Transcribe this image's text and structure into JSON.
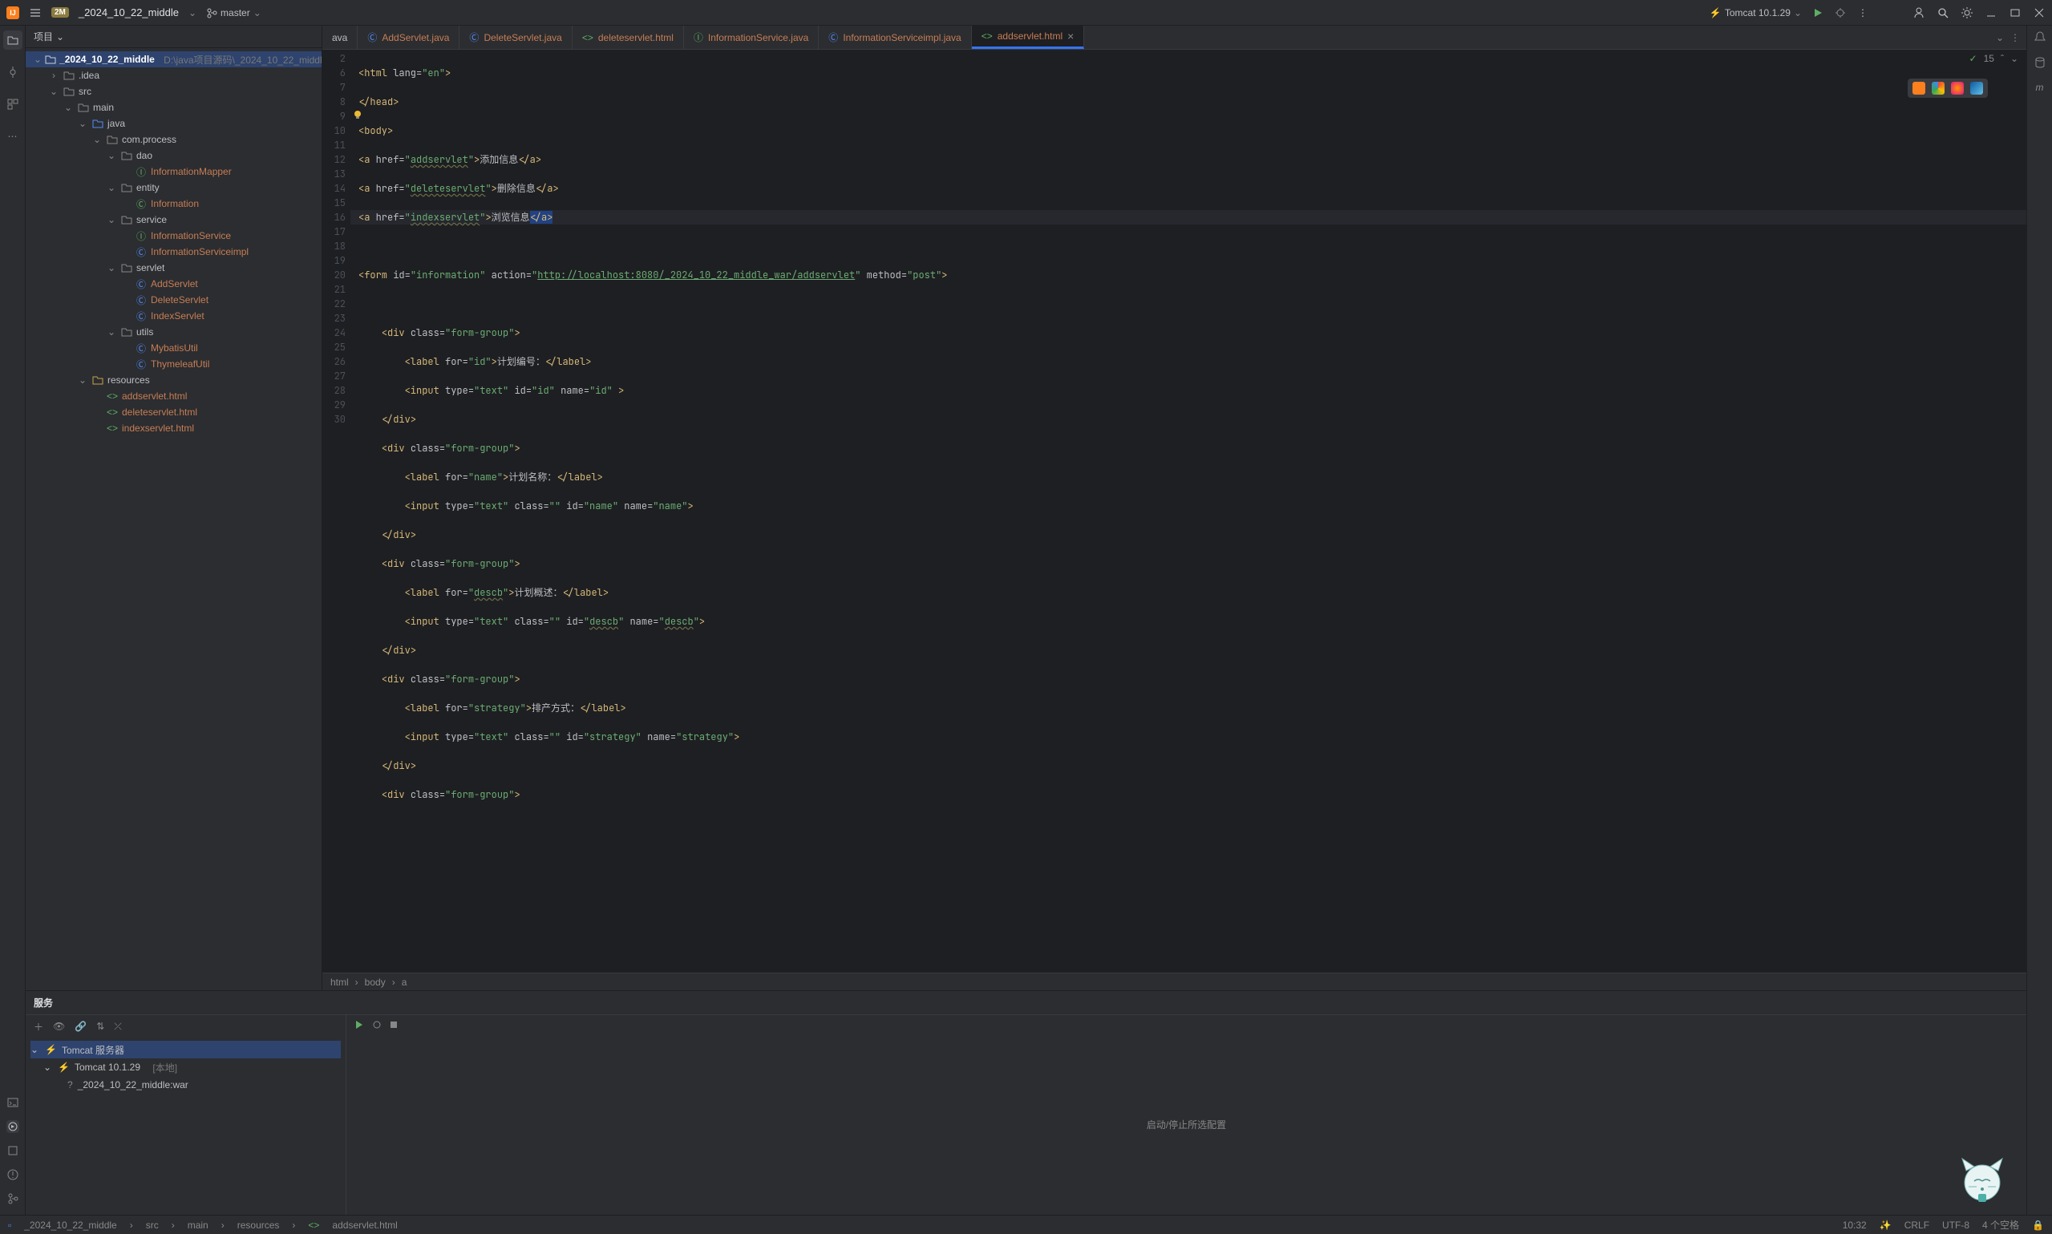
{
  "title": {
    "project": "_2024_10_22_middle",
    "branch": "master",
    "runconfig": "Tomcat 10.1.29"
  },
  "sidebar": {
    "header": "项目",
    "root": {
      "name": "_2024_10_22_middle",
      "path": "D:\\java项目源码\\_2024_10_22_middle"
    },
    "nodes": {
      "idea": ".idea",
      "src": "src",
      "main": "main",
      "java": "java",
      "com_process": "com.process",
      "dao": "dao",
      "InformationMapper": "InformationMapper",
      "entity": "entity",
      "Information": "Information",
      "service": "service",
      "InformationService": "InformationService",
      "InformationServiceimpl": "InformationServiceimpl",
      "servlet": "servlet",
      "AddServlet": "AddServlet",
      "DeleteServlet": "DeleteServlet",
      "IndexServlet": "IndexServlet",
      "utils": "utils",
      "MybatisUtil": "MybatisUtil",
      "ThymeleafUtil": "ThymeleafUtil",
      "resources": "resources",
      "addservlet_html": "addservlet.html",
      "deleteservlet_html": "deleteservlet.html",
      "indexservlet_html": "indexservlet.html"
    }
  },
  "tabs": [
    {
      "icon": "class",
      "label": "ava"
    },
    {
      "icon": "class",
      "label": "AddServlet.java"
    },
    {
      "icon": "class",
      "label": "DeleteServlet.java"
    },
    {
      "icon": "html",
      "label": "deleteservlet.html"
    },
    {
      "icon": "interface",
      "label": "InformationService.java"
    },
    {
      "icon": "class",
      "label": "InformationServiceimpl.java"
    },
    {
      "icon": "html",
      "label": "addservlet.html",
      "active": true
    }
  ],
  "editor": {
    "warnings": "15",
    "lines": [
      "2",
      "6",
      "7",
      "8",
      "9",
      "10",
      "11",
      "12",
      "13",
      "14",
      "15",
      "16",
      "17",
      "18",
      "19",
      "20",
      "21",
      "22",
      "23",
      "24",
      "25",
      "26",
      "27",
      "28",
      "29",
      "30"
    ]
  },
  "breadcrumb": [
    "html",
    "body",
    "a"
  ],
  "services": {
    "title": "服务",
    "root": "Tomcat 服务器",
    "node1": "Tomcat 10.1.29",
    "node1_suffix": "[本地]",
    "node2": "_2024_10_22_middle:war",
    "msg": "启动/停止所选配置"
  },
  "statusbar": {
    "crumb_proj": "_2024_10_22_middle",
    "crumb_src": "src",
    "crumb_main": "main",
    "crumb_res": "resources",
    "crumb_file": "addservlet.html",
    "pos": "10:32",
    "eol": "CRLF",
    "enc": "UTF-8",
    "indent": "4 个空格"
  },
  "code": {
    "l2": "<html lang=\"en\">",
    "l6": "</head>",
    "l7": "<body>",
    "l8_href": "addservlet",
    "l8_txt": "添加信息",
    "l9_href": "deleteservlet",
    "l9_txt": "删除信息",
    "l10_href": "indexservlet",
    "l10_txt": "浏览信息",
    "l12_action": "http://localhost:8080/_2024_10_22_middle_war/addservlet",
    "l15_txt": "计划编号：",
    "l18_txt": "计划名称：",
    "l23_txt": "计划概述：",
    "l27_txt": "排产方式："
  }
}
